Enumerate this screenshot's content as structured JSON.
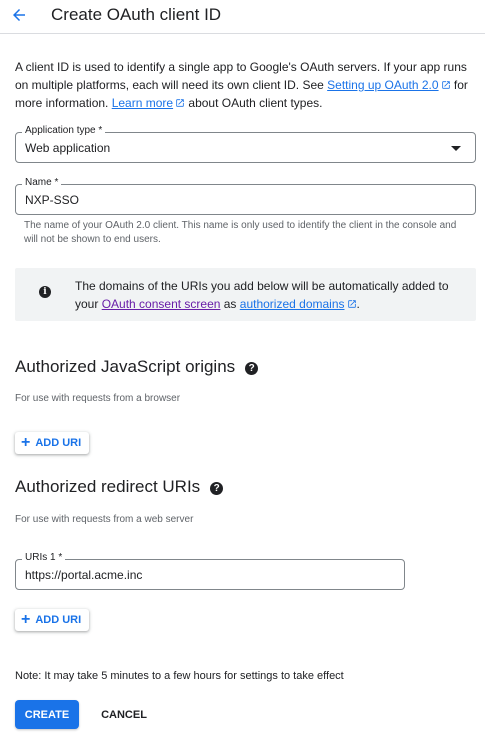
{
  "header": {
    "title": "Create OAuth client ID",
    "back_icon": "arrow-back-icon"
  },
  "intro": {
    "text1": "A client ID is used to identify a single app to Google's OAuth servers. If your app runs on multiple platforms, each will need its own client ID. See ",
    "link1": "Setting up OAuth 2.0",
    "text2": " for more information. ",
    "link2": "Learn more",
    "text3": " about OAuth client types."
  },
  "app_type": {
    "label": "Application type *",
    "value": "Web application"
  },
  "name_field": {
    "label": "Name *",
    "value": "NXP-SSO",
    "helper": "The name of your OAuth 2.0 client. This name is only used to identify the client in the console and will not be shown to end users."
  },
  "info": {
    "text1": "The domains of the URIs you add below will be automatically added to your ",
    "link1": "OAuth consent screen",
    "text2": " as ",
    "link2": "authorized domains",
    "text3": "."
  },
  "js_origins": {
    "title": "Authorized JavaScript origins",
    "subtitle": "For use with requests from a browser",
    "add_label": "ADD URI"
  },
  "redirect_uris": {
    "title": "Authorized redirect URIs",
    "subtitle": "For use with requests from a web server",
    "uri1_label": "URIs 1 *",
    "uri1_value": "https://portal.acme.inc",
    "add_label": "ADD URI"
  },
  "footer": {
    "note": "Note: It may take 5 minutes to a few hours for settings to take effect",
    "create": "CREATE",
    "cancel": "CANCEL"
  },
  "colors": {
    "accent": "#1a73e8",
    "visited_link": "#681da8",
    "info_bg": "#f1f3f4"
  }
}
